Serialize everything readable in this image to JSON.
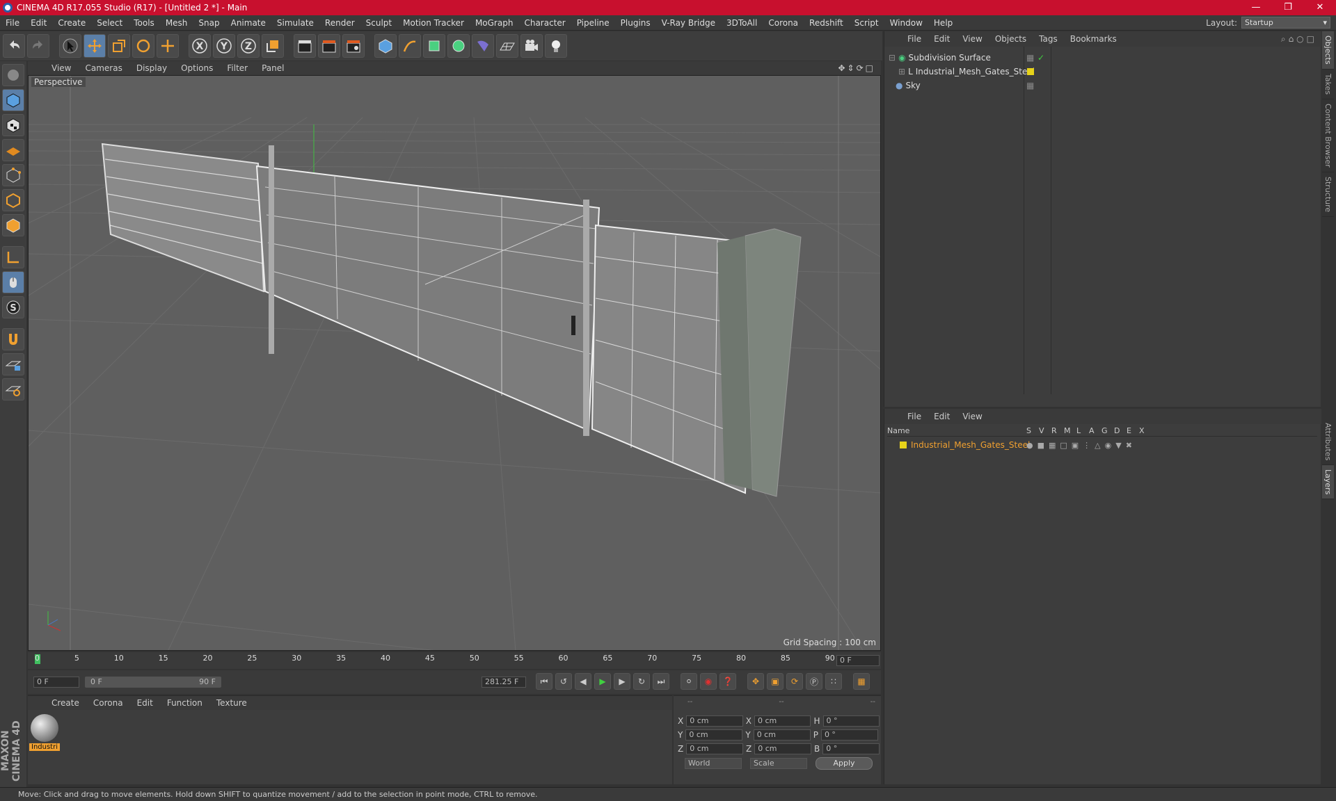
{
  "window": {
    "title": "CINEMA 4D R17.055 Studio (R17) - [Untitled 2 *] - Main"
  },
  "menu": [
    "File",
    "Edit",
    "Create",
    "Select",
    "Tools",
    "Mesh",
    "Snap",
    "Animate",
    "Simulate",
    "Render",
    "Sculpt",
    "Motion Tracker",
    "MoGraph",
    "Character",
    "Pipeline",
    "Plugins",
    "V-Ray Bridge",
    "3DToAll",
    "Corona",
    "Redshift",
    "Script",
    "Window",
    "Help"
  ],
  "layout": {
    "label": "Layout:",
    "value": "Startup"
  },
  "viewport": {
    "menu": [
      "View",
      "Cameras",
      "Display",
      "Options",
      "Filter",
      "Panel"
    ],
    "label": "Perspective",
    "grid_spacing": "Grid Spacing : 100 cm"
  },
  "timeline": {
    "ticks": [
      "0",
      "5",
      "10",
      "15",
      "20",
      "25",
      "30",
      "35",
      "40",
      "45",
      "50",
      "55",
      "60",
      "65",
      "70",
      "75",
      "80",
      "85",
      "90"
    ],
    "current_frame": "0 F",
    "start": "0 F",
    "range_start": "0 F",
    "range_end": "90 F",
    "fps_field": "281.25 F"
  },
  "objects": {
    "menu": [
      "File",
      "Edit",
      "View",
      "Objects",
      "Tags",
      "Bookmarks"
    ],
    "items": [
      "Subdivision Surface",
      "Industrial_Mesh_Gates_Steel",
      "Sky"
    ]
  },
  "layers": {
    "menu": [
      "File",
      "Edit",
      "View"
    ],
    "columns": [
      "Name",
      "S",
      "V",
      "R",
      "M",
      "L",
      "A",
      "G",
      "D",
      "E",
      "X"
    ],
    "items": [
      "Industrial_Mesh_Gates_Steel"
    ]
  },
  "materials": {
    "menu": [
      "Create",
      "Corona",
      "Edit",
      "Function",
      "Texture"
    ],
    "items": [
      "Industri"
    ]
  },
  "coords": {
    "headers": [
      "--",
      "--",
      "--"
    ],
    "rows": [
      {
        "a": "X",
        "av": "0 cm",
        "b": "X",
        "bv": "0 cm",
        "c": "H",
        "cv": "0 °"
      },
      {
        "a": "Y",
        "av": "0 cm",
        "b": "Y",
        "bv": "0 cm",
        "c": "P",
        "cv": "0 °"
      },
      {
        "a": "Z",
        "av": "0 cm",
        "b": "Z",
        "bv": "0 cm",
        "c": "B",
        "cv": "0 °"
      }
    ],
    "mode1": "World",
    "mode2": "Scale",
    "apply": "Apply"
  },
  "sidetabs": [
    "Objects",
    "Takes",
    "Content Browser",
    "Structure",
    "Attributes",
    "Layers"
  ],
  "status": "Move: Click and drag to move elements. Hold down SHIFT to quantize movement / add to the selection in point mode, CTRL to remove.",
  "branding": "MAXON CINEMA 4D",
  "colors": {
    "accent": "#c8102e",
    "selected": "#f0a030",
    "layer": "#e6d21a"
  }
}
